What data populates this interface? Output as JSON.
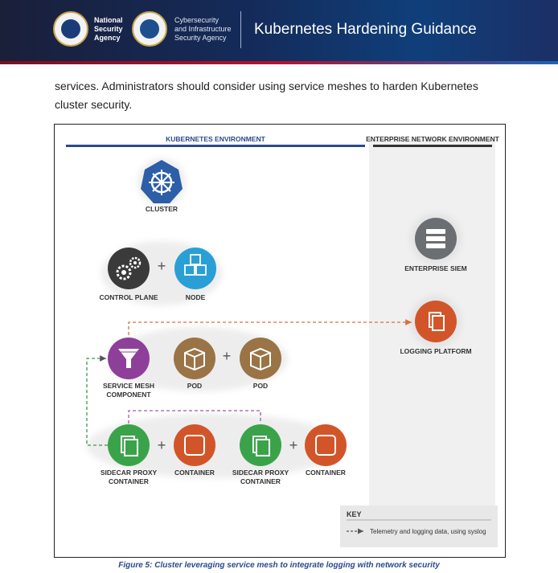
{
  "header": {
    "nsa_lines": [
      "National",
      "Security",
      "Agency"
    ],
    "cisa_lines": [
      "Cybersecurity",
      "and Infrastructure",
      "Security Agency"
    ],
    "title": "Kubernetes Hardening Guidance"
  },
  "body": {
    "text": "services. Administrators should consider using service meshes to harden Kubernetes cluster security."
  },
  "figure": {
    "k8s_env_label": "KUBERNETES ENVIRONMENT",
    "enterprise_env_label": "ENTERPRISE NETWORK ENVIRONMENT",
    "cluster_label": "CLUSTER",
    "control_plane_label": "CONTROL PLANE",
    "node_label": "NODE",
    "service_mesh_label_1": "SERVICE MESH",
    "service_mesh_label_2": "COMPONENT",
    "pod_label_1": "POD",
    "pod_label_2": "POD",
    "sidecar1_label_1": "SIDECAR PROXY",
    "sidecar1_label_2": "CONTAINER",
    "container1_label": "CONTAINER",
    "sidecar2_label_1": "SIDECAR PROXY",
    "sidecar2_label_2": "CONTAINER",
    "container2_label": "CONTAINER",
    "siem_label": "ENTERPRISE SIEM",
    "logging_label": "LOGGING PLATFORM",
    "plus": "+",
    "key_title": "KEY",
    "key_text": "Telemetry and logging data, using syslog",
    "key_arrow": "-->",
    "colors": {
      "navy": "#2b4a8c",
      "dark": "#3a3a3a",
      "teal": "#2a9fd6",
      "purple": "#8e3f9a",
      "tan": "#9a7446",
      "green": "#3aa34a",
      "orange": "#d2552a",
      "gray": "#6b6e72",
      "dash_green": "#3a9a4a",
      "dash_purple": "#9a5aa8",
      "dash_orange": "#d8703a"
    }
  },
  "caption": "Figure 5: Cluster leveraging service mesh to integrate logging with network security"
}
